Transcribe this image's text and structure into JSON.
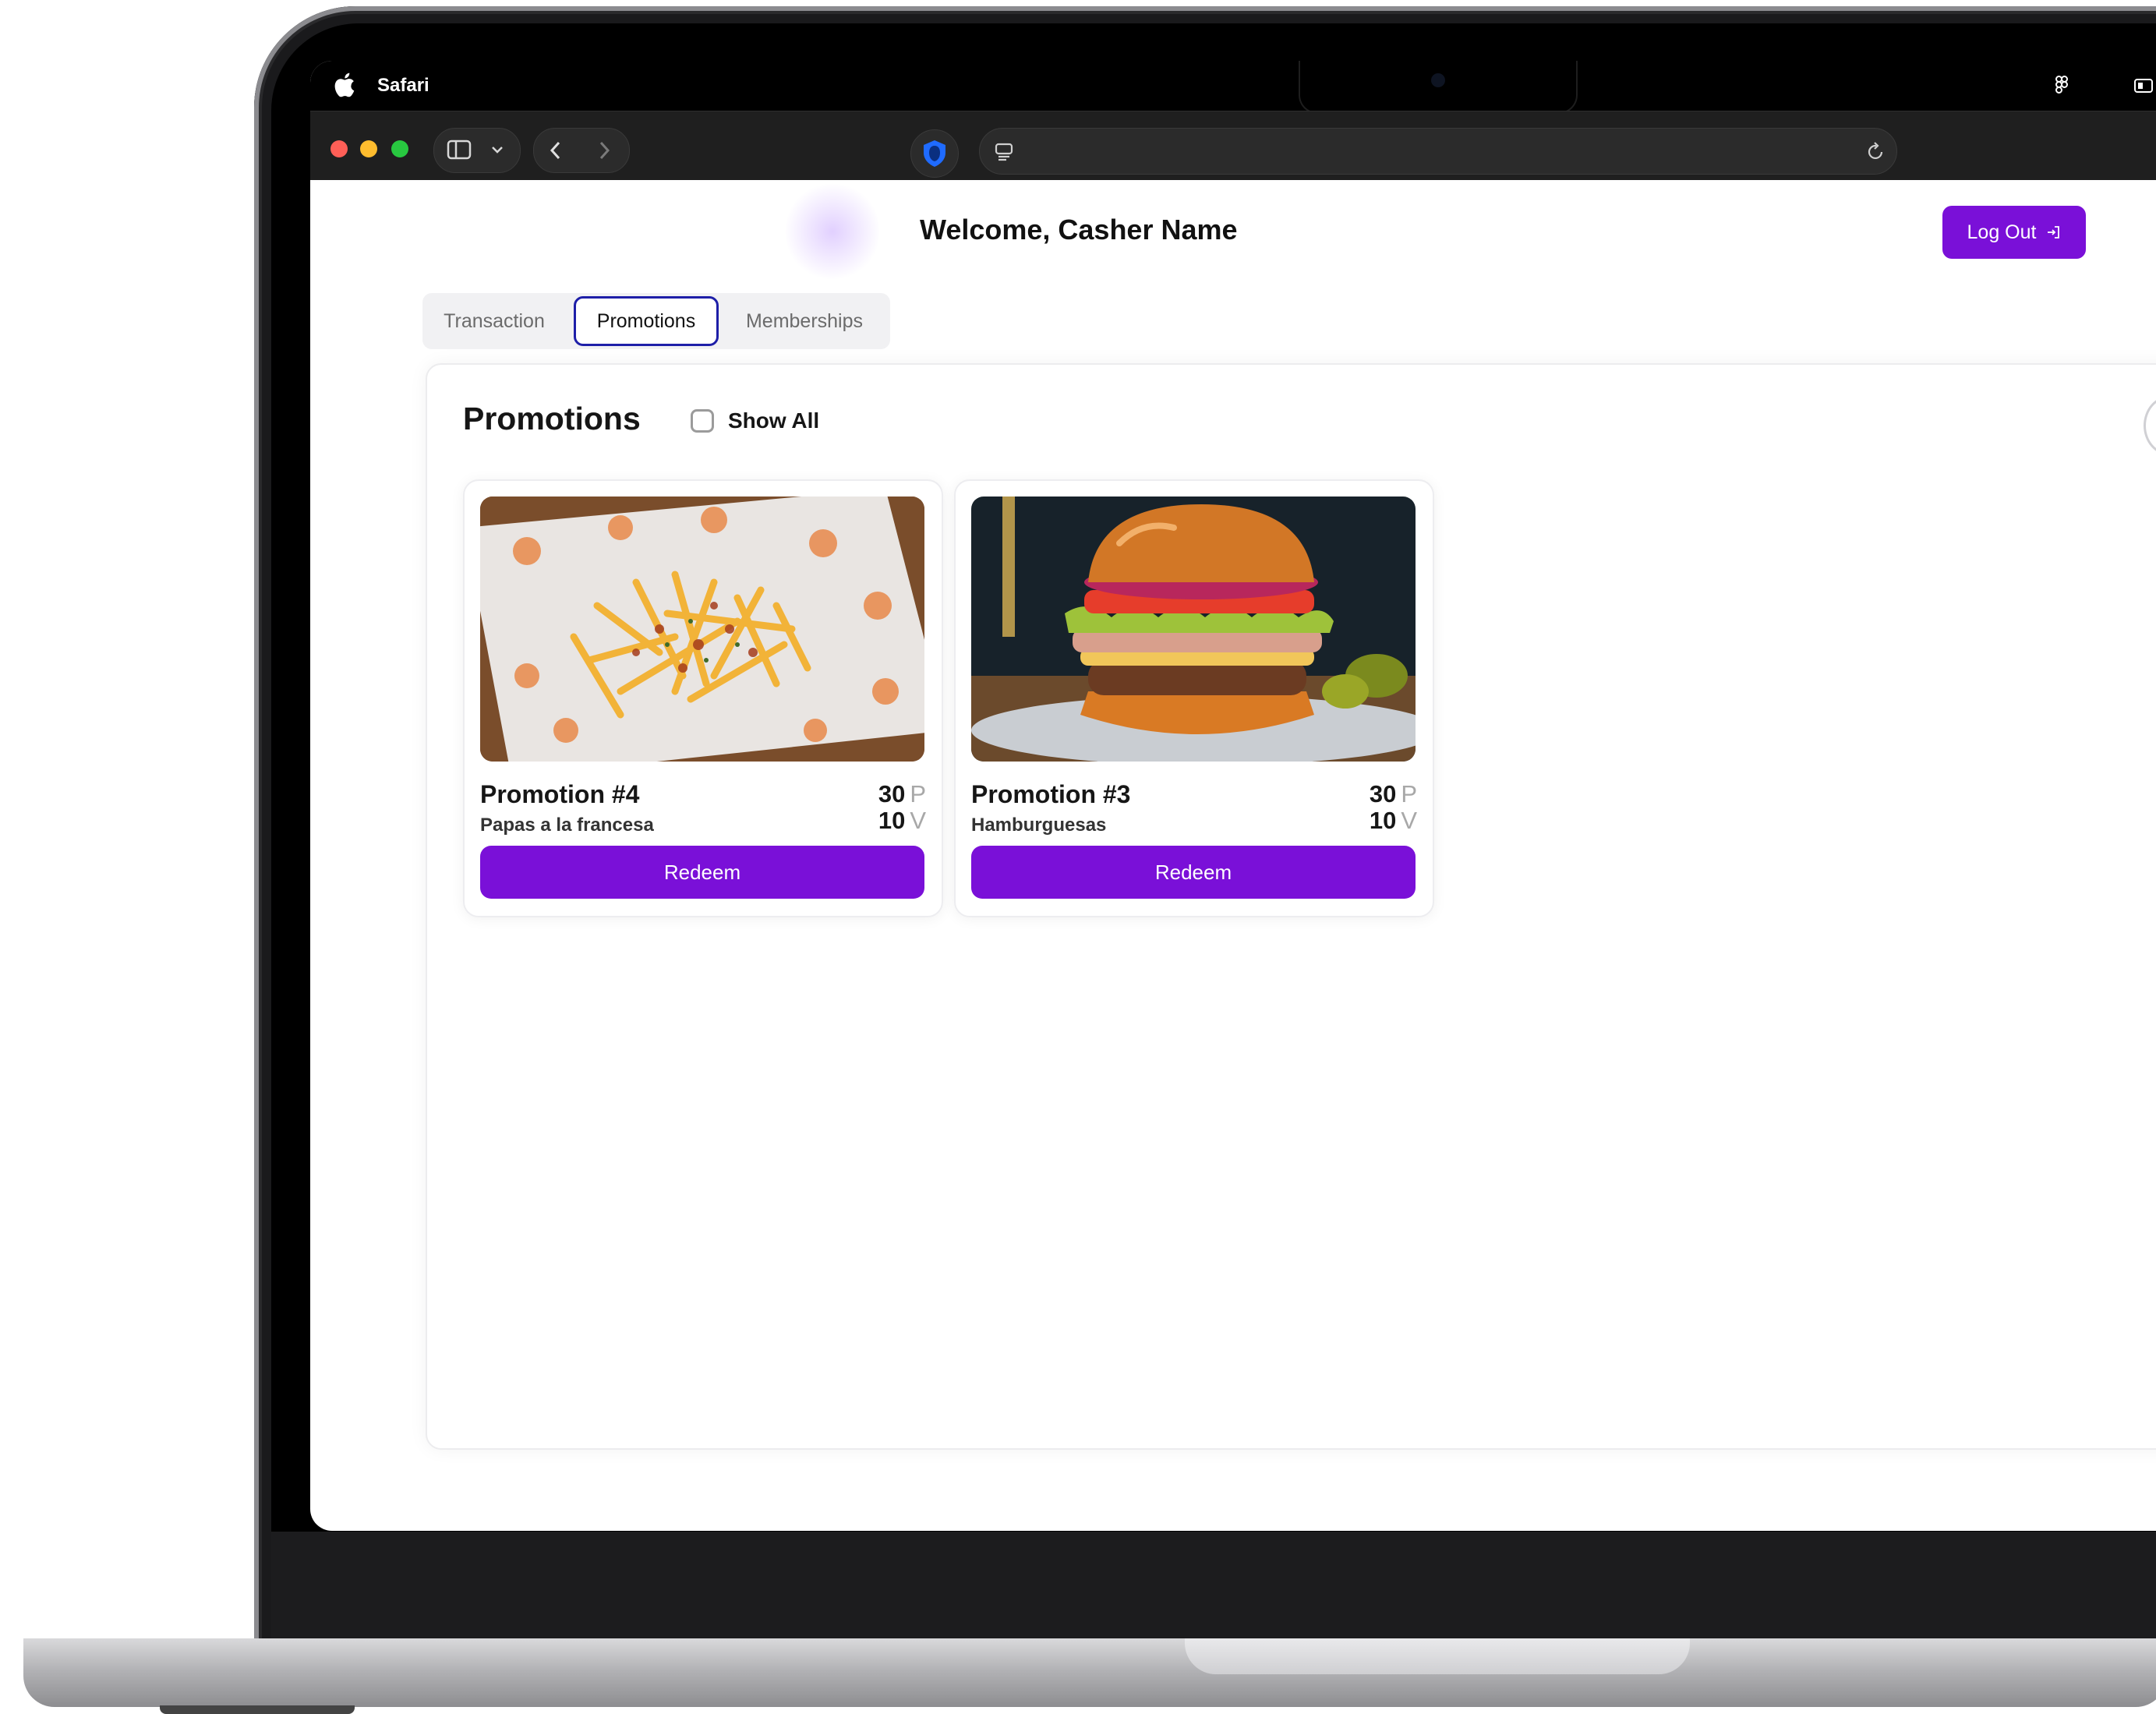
{
  "menubar": {
    "app_name": "Safari"
  },
  "page": {
    "welcome": "Welcome, Casher Name",
    "logout_label": "Log Out"
  },
  "tabs": [
    {
      "label": "Transaction",
      "active": false
    },
    {
      "label": "Promotions",
      "active": true
    },
    {
      "label": "Memberships",
      "active": false
    }
  ],
  "promotions": {
    "title": "Promotions",
    "show_all_label": "Show All",
    "show_all_checked": false,
    "cards": [
      {
        "title": "Promotion #4",
        "subtitle": "Papas a la francesa",
        "points": "30",
        "points_unit": "P",
        "visits": "10",
        "visits_unit": "V",
        "button": "Redeem",
        "image": "loaded-fries-photo"
      },
      {
        "title": "Promotion #3",
        "subtitle": "Hamburguesas",
        "points": "30",
        "points_unit": "P",
        "visits": "10",
        "visits_unit": "V",
        "button": "Redeem",
        "image": "burger-photo"
      }
    ]
  },
  "colors": {
    "accent": "#7a10d8",
    "active_tab_border": "#1e1fa8"
  }
}
